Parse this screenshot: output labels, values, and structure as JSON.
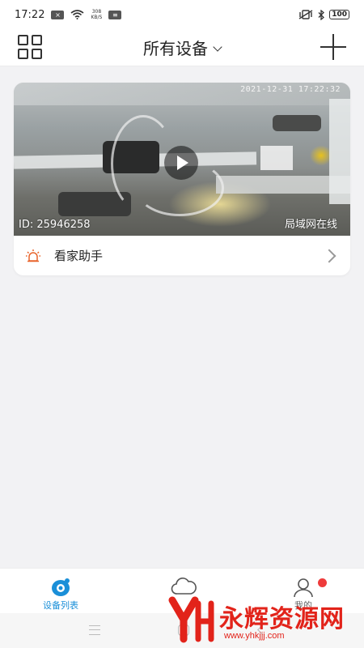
{
  "status_bar": {
    "time": "17:22",
    "network_speed_value": "308",
    "network_speed_unit": "KB/S",
    "battery": "100"
  },
  "header": {
    "title": "所有设备"
  },
  "device_card": {
    "timestamp": "2021-12-31  17:22:32",
    "device_id": "ID: 25946258",
    "status": "局域网在线",
    "feature_label": "看家助手"
  },
  "tabbar": {
    "tabs": [
      {
        "label": "设备列表",
        "active": true
      },
      {
        "label": "",
        "active": false
      },
      {
        "label": "我的",
        "active": false
      }
    ]
  },
  "colors": {
    "accent": "#1a8fd8",
    "alarm_icon": "#e8632a",
    "notification_dot": "#ee3b3b",
    "watermark": "#e2231a"
  },
  "watermark": {
    "text": "永辉资源网",
    "url": "www.yhkjjj.com"
  }
}
